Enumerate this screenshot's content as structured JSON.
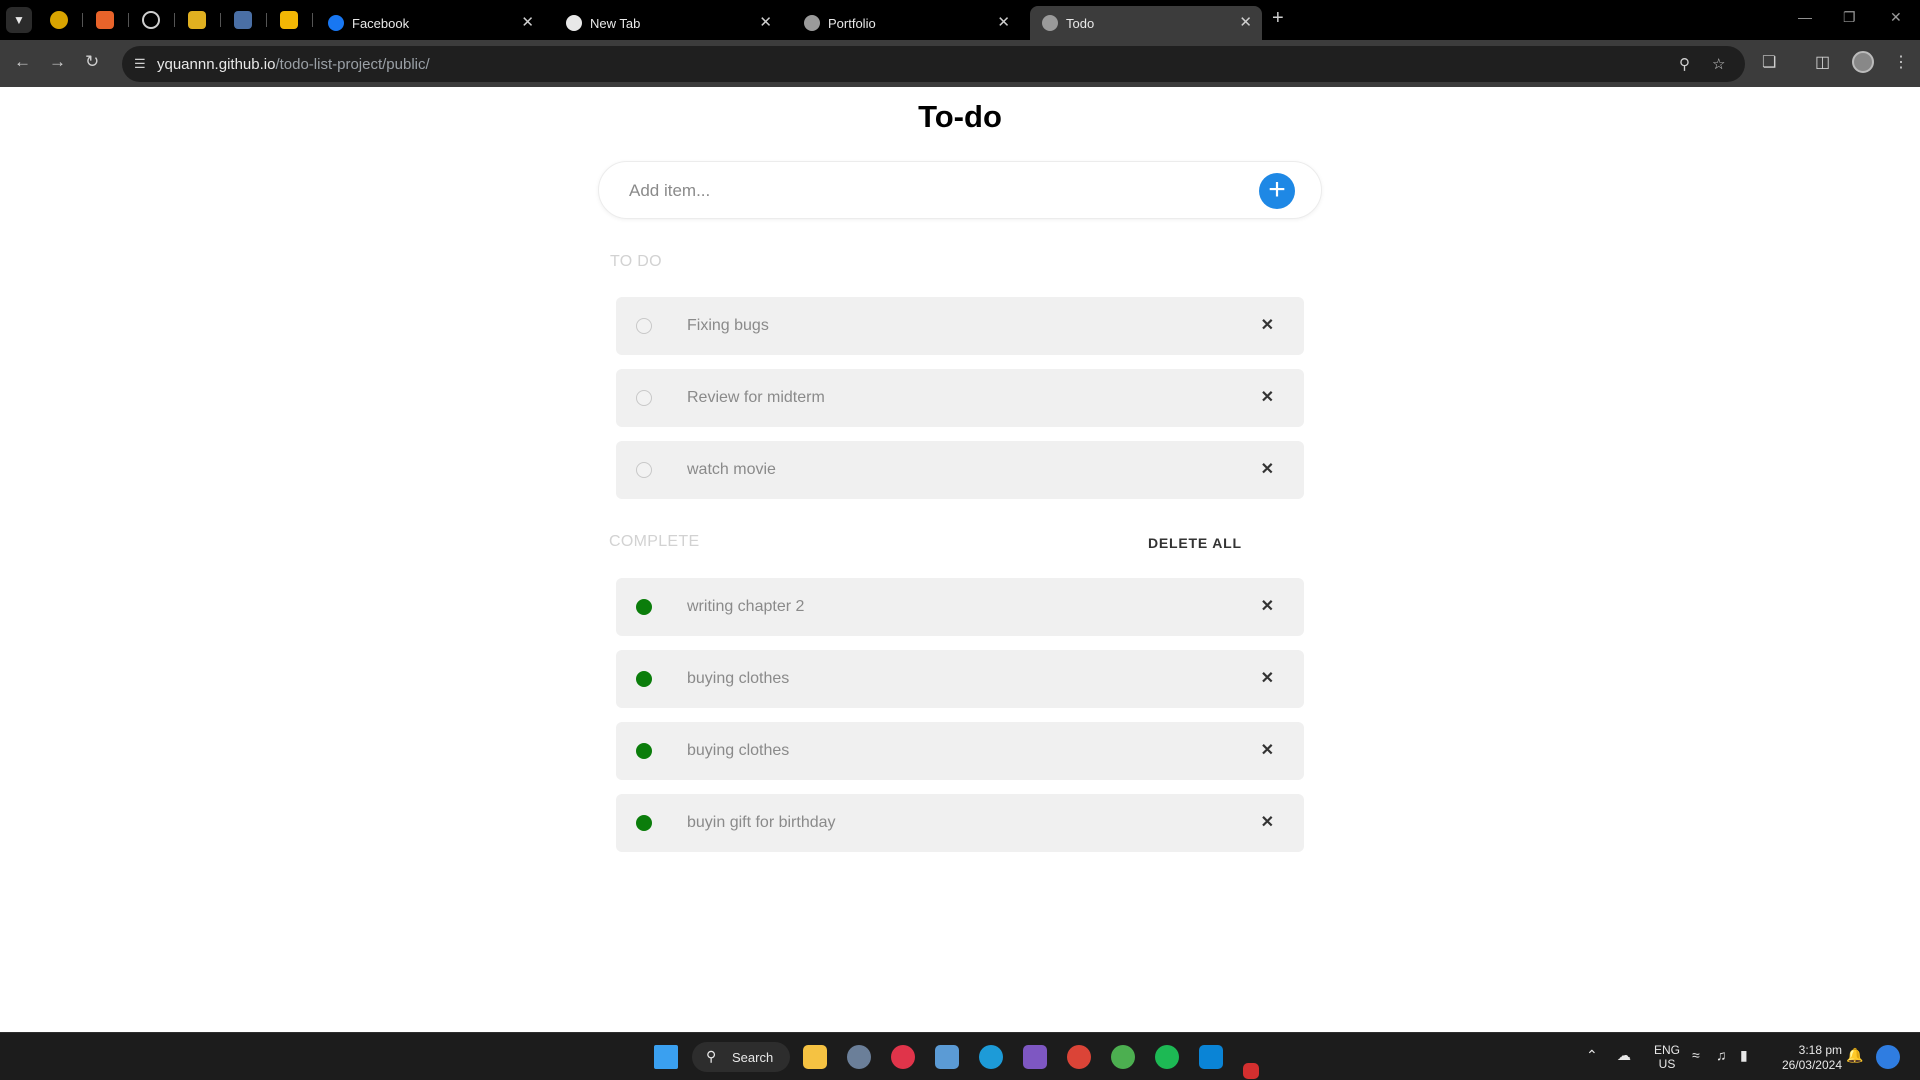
{
  "browser": {
    "tabs": [
      {
        "title": "Facebook",
        "active": false
      },
      {
        "title": "New Tab",
        "active": false
      },
      {
        "title": "Portfolio",
        "active": false
      },
      {
        "title": "Todo",
        "active": true
      }
    ],
    "url_host": "yquannn.github.io",
    "url_path": "/todo-list-project/public/"
  },
  "app": {
    "title": "To-do",
    "add_placeholder": "Add item...",
    "add_icon": "+",
    "todo_section_label": "TO DO",
    "complete_section_label": "COMPLETE",
    "delete_all_label": "DELETE ALL",
    "todo_items": [
      {
        "text": "Fixing bugs"
      },
      {
        "text": "Review for midterm"
      },
      {
        "text": "watch movie"
      }
    ],
    "complete_items": [
      {
        "text": "writing chapter 2"
      },
      {
        "text": "buying clothes"
      },
      {
        "text": "buying clothes"
      },
      {
        "text": "buyin gift for birthday"
      }
    ],
    "remove_glyph": "✕",
    "colors": {
      "accent": "#1e88e5",
      "done": "#0b7d0b"
    }
  },
  "taskbar": {
    "search_label": "Search",
    "lang_line1": "ENG",
    "lang_line2": "US",
    "time": "3:18 pm",
    "date": "26/03/2024"
  }
}
